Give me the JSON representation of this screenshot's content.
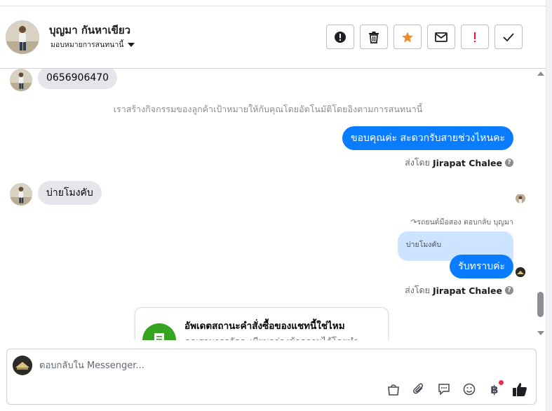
{
  "header": {
    "contact_name": "บุญมา กันหาเขียว",
    "assign_label": "มอบหมายการสนทนานี้",
    "toolbar": [
      {
        "name": "spam-button",
        "icon": "alert-circle-icon"
      },
      {
        "name": "delete-button",
        "icon": "trash-icon"
      },
      {
        "name": "star-button",
        "icon": "star-icon",
        "color": "#f28c28"
      },
      {
        "name": "mark-unread-button",
        "icon": "envelope-icon"
      },
      {
        "name": "important-button",
        "icon": "exclamation-icon",
        "color": "#e41e3f"
      },
      {
        "name": "done-button",
        "icon": "check-icon"
      }
    ]
  },
  "chat": {
    "messages": {
      "phone_number": "0656906470",
      "system_note": "เราสร้างกิจกรรมของลูกค้าเป้าหมายให้กับคุณโดยอัตโนมัติโดยอิงตามการสนทนานี้",
      "out_thanks": "ขอบคุณค่ะ สะดวกรับสายช่วงไหนคะ",
      "sent_by_prefix": "ส่งโดย",
      "sent_by_name": "Jirapat Chalee",
      "in_afternoon": "บ่ายโมงคับ",
      "reply_label": "รถยนต์มือสอง ตอบกลับ บุญมา",
      "quoted_text": "บ่ายโมงคับ",
      "out_ack": "รับทราบค่ะ",
      "sent_by_prefix_2": "ส่งโดย",
      "sent_by_name_2": "Jirapat Chalee"
    },
    "card": {
      "title": "อัพเดตสถานะคำสั่งซื้อของแชทนี้ใช่ไหม",
      "body": "คุณสามารถจัดระเบียบกล่องข้อความได้โดยทำ"
    }
  },
  "composer": {
    "placeholder": "ตอบกลับใน Messenger...",
    "tools": [
      "shopping-bag-icon",
      "paperclip-icon",
      "chat-bubble-icon",
      "emoji-icon",
      "baht-icon",
      "thumbs-up-icon"
    ],
    "baht_symbol": "฿"
  },
  "colors": {
    "accent_blue": "#0a7cff",
    "star_orange": "#f28c28",
    "important_red": "#e41e3f",
    "card_green": "#36a420"
  }
}
